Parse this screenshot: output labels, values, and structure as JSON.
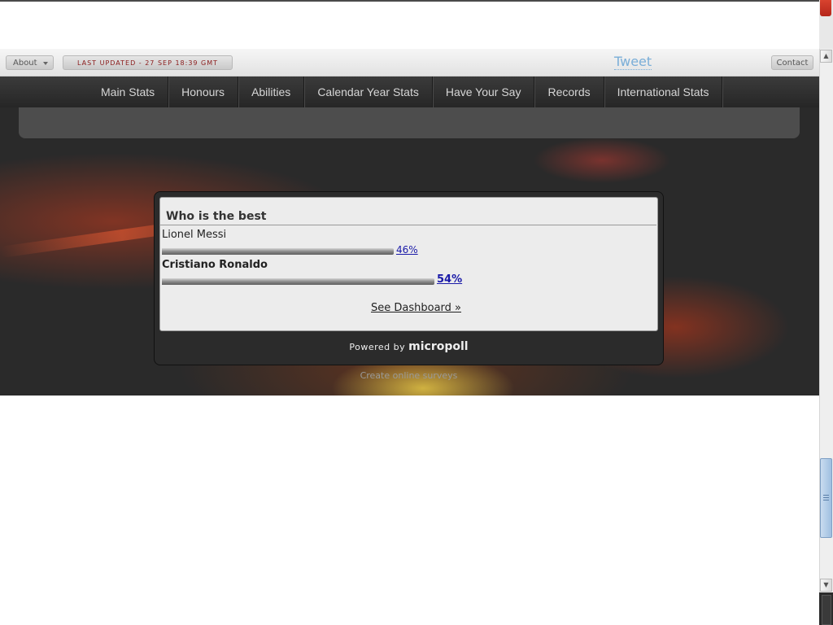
{
  "toolbar": {
    "about_label": "About",
    "last_updated": "LAST UPDATED - 27 SEP 18:39 GMT",
    "tweet_label": "Tweet",
    "contact_label": "Contact"
  },
  "nav": {
    "items": [
      {
        "label": "Main Stats"
      },
      {
        "label": "Honours"
      },
      {
        "label": "Abilities"
      },
      {
        "label": "Calendar Year Stats"
      },
      {
        "label": "Have Your Say"
      },
      {
        "label": "Records"
      },
      {
        "label": "International Stats"
      }
    ]
  },
  "poll": {
    "title": "Who is the best",
    "options": [
      {
        "label": "Lionel Messi",
        "percent_label": "46%",
        "percent": 46
      },
      {
        "label": "Cristiano Ronaldo",
        "percent_label": "54%",
        "percent": 54
      }
    ],
    "dashboard_link": "See Dashboard »",
    "powered_prefix": "Powered by",
    "powered_brand": "micropoll",
    "create_text": "Create online surveys"
  },
  "colors": {
    "accent_link": "#1a1aa8",
    "nav_background": "#262626",
    "updated_text": "#8a1a1a"
  }
}
